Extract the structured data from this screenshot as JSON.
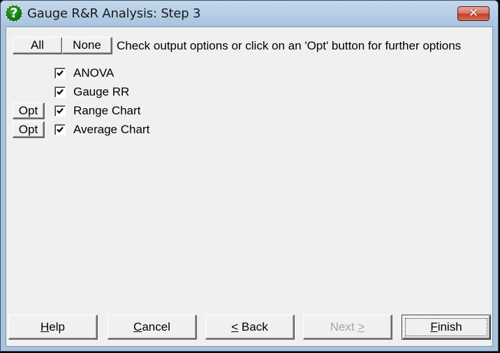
{
  "window": {
    "title": "Gauge R&R Analysis: Step 3",
    "icon": "help-question-icon",
    "close_label": "✕"
  },
  "toolbar": {
    "all_label": "All",
    "none_label": "None",
    "instruction": "Check output options or click on an 'Opt' button for further options"
  },
  "options": [
    {
      "label": "ANOVA",
      "checked": true,
      "has_opt": false
    },
    {
      "label": "Gauge RR",
      "checked": true,
      "has_opt": false
    },
    {
      "label": "Range Chart",
      "checked": true,
      "has_opt": true,
      "opt_label": "Opt"
    },
    {
      "label": "Average Chart",
      "checked": true,
      "has_opt": true,
      "opt_label": "Opt"
    }
  ],
  "footer": {
    "help": {
      "pre": "",
      "accel": "H",
      "post": "elp",
      "enabled": true
    },
    "cancel": {
      "pre": "",
      "accel": "C",
      "post": "ancel",
      "enabled": true
    },
    "back": {
      "pre": "",
      "accel": "<",
      "post": " Back",
      "enabled": true
    },
    "next": {
      "pre": "Next ",
      "accel": ">",
      "post": "",
      "enabled": false
    },
    "finish": {
      "pre": "",
      "accel": "F",
      "post": "inish",
      "enabled": true,
      "default": true
    }
  }
}
